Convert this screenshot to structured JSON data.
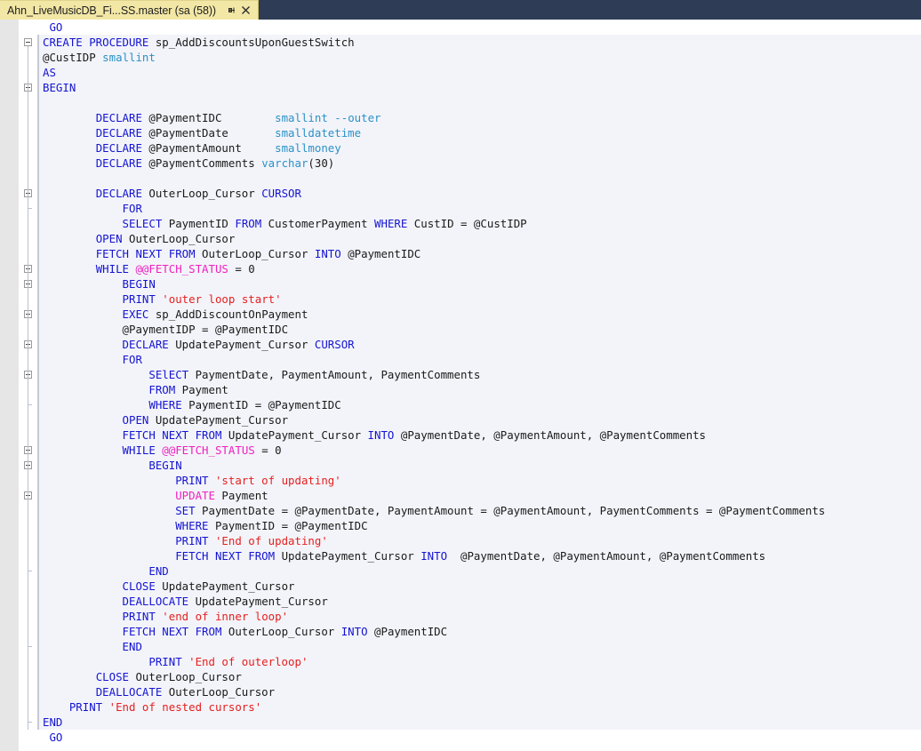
{
  "window": {
    "tab_background": "#2e3c56",
    "active_tab_background": "#f3e7a6",
    "editor_background": "#ffffff",
    "statement_band_background": "#f3f4f9"
  },
  "tab": {
    "title": "Ahn_LiveMusicDB_Fi...SS.master (sa (58))",
    "pin_icon": "pin-icon",
    "close_icon": "close-icon"
  },
  "colors": {
    "keyword": "#1414d2",
    "datatype": "#2b91c8",
    "string": "#e52020",
    "global_variable": "#f020c0",
    "plain_text": "#1a1a1a"
  },
  "editor": {
    "language": "T-SQL",
    "lines": [
      {
        "indent": 1,
        "tokens": [
          {
            "t": "GO",
            "c": "kw"
          }
        ]
      },
      {
        "indent": 0,
        "fold": "start",
        "tokens": [
          {
            "t": "CREATE PROCEDURE ",
            "c": "kw"
          },
          {
            "t": "sp_AddDiscountsUponGuestSwitch",
            "c": "pln"
          }
        ]
      },
      {
        "indent": 0,
        "tokens": [
          {
            "t": "@CustIDP",
            "c": "pln"
          },
          {
            "t": " ",
            "c": "pln"
          },
          {
            "t": "smallint",
            "c": "typ"
          }
        ]
      },
      {
        "indent": 0,
        "tokens": [
          {
            "t": "AS",
            "c": "kw"
          }
        ]
      },
      {
        "indent": 0,
        "fold": "start",
        "tokens": [
          {
            "t": "BEGIN",
            "c": "kw"
          }
        ]
      },
      {
        "indent": 0,
        "tokens": []
      },
      {
        "indent": 8,
        "tokens": [
          {
            "t": "DECLARE ",
            "c": "kw"
          },
          {
            "t": "@PaymentIDC",
            "c": "pln"
          },
          {
            "t": "        ",
            "c": "pln"
          },
          {
            "t": "smallint",
            "c": "typ"
          },
          {
            "t": " ",
            "c": "pln"
          },
          {
            "t": "--outer",
            "c": "typ"
          }
        ]
      },
      {
        "indent": 8,
        "tokens": [
          {
            "t": "DECLARE ",
            "c": "kw"
          },
          {
            "t": "@PaymentDate",
            "c": "pln"
          },
          {
            "t": "       ",
            "c": "pln"
          },
          {
            "t": "smalldatetime",
            "c": "typ"
          }
        ]
      },
      {
        "indent": 8,
        "tokens": [
          {
            "t": "DECLARE ",
            "c": "kw"
          },
          {
            "t": "@PaymentAmount",
            "c": "pln"
          },
          {
            "t": "     ",
            "c": "pln"
          },
          {
            "t": "smallmoney",
            "c": "typ"
          }
        ]
      },
      {
        "indent": 8,
        "tokens": [
          {
            "t": "DECLARE ",
            "c": "kw"
          },
          {
            "t": "@PaymentComments",
            "c": "pln"
          },
          {
            "t": " ",
            "c": "pln"
          },
          {
            "t": "varchar",
            "c": "typ"
          },
          {
            "t": "(30)",
            "c": "pln"
          }
        ]
      },
      {
        "indent": 8,
        "tokens": []
      },
      {
        "indent": 8,
        "fold": "start",
        "tokens": [
          {
            "t": "DECLARE ",
            "c": "kw"
          },
          {
            "t": "OuterLoop_Cursor ",
            "c": "pln"
          },
          {
            "t": "CURSOR",
            "c": "kw"
          }
        ]
      },
      {
        "indent": 12,
        "tokens": [
          {
            "t": "FOR",
            "c": "kw"
          }
        ]
      },
      {
        "indent": 12,
        "tokens": [
          {
            "t": "SELECT ",
            "c": "kw"
          },
          {
            "t": "PaymentID ",
            "c": "pln"
          },
          {
            "t": "FROM ",
            "c": "kw"
          },
          {
            "t": "CustomerPayment ",
            "c": "pln"
          },
          {
            "t": "WHERE ",
            "c": "kw"
          },
          {
            "t": "CustID = @CustIDP",
            "c": "pln"
          }
        ]
      },
      {
        "indent": 8,
        "tokens": [
          {
            "t": "OPEN ",
            "c": "kw"
          },
          {
            "t": "OuterLoop_Cursor",
            "c": "pln"
          }
        ]
      },
      {
        "indent": 8,
        "tokens": [
          {
            "t": "FETCH NEXT FROM ",
            "c": "kw"
          },
          {
            "t": "OuterLoop_Cursor ",
            "c": "pln"
          },
          {
            "t": "INTO ",
            "c": "kw"
          },
          {
            "t": "@PaymentIDC",
            "c": "pln"
          }
        ]
      },
      {
        "indent": 8,
        "fold": "start",
        "tokens": [
          {
            "t": "WHILE ",
            "c": "kw"
          },
          {
            "t": "@@FETCH_STATUS",
            "c": "glb"
          },
          {
            "t": " = 0",
            "c": "pln"
          }
        ]
      },
      {
        "indent": 12,
        "fold": "start",
        "tokens": [
          {
            "t": "BEGIN",
            "c": "kw"
          }
        ]
      },
      {
        "indent": 12,
        "tokens": [
          {
            "t": "PRINT ",
            "c": "kw"
          },
          {
            "t": "'outer loop start'",
            "c": "str"
          }
        ]
      },
      {
        "indent": 12,
        "fold": "start",
        "tokens": [
          {
            "t": "EXEC ",
            "c": "kw"
          },
          {
            "t": "sp_AddDiscountOnPayment",
            "c": "pln"
          }
        ]
      },
      {
        "indent": 12,
        "tokens": [
          {
            "t": "@PaymentIDP = @PaymentIDC",
            "c": "pln"
          }
        ]
      },
      {
        "indent": 12,
        "fold": "start",
        "tokens": [
          {
            "t": "DECLARE ",
            "c": "kw"
          },
          {
            "t": "UpdatePayment_Cursor ",
            "c": "pln"
          },
          {
            "t": "CURSOR",
            "c": "kw"
          }
        ]
      },
      {
        "indent": 12,
        "tokens": [
          {
            "t": "FOR",
            "c": "kw"
          }
        ]
      },
      {
        "indent": 16,
        "fold": "start",
        "tokens": [
          {
            "t": "SElECT ",
            "c": "kw"
          },
          {
            "t": "PaymentDate, PaymentAmount, PaymentComments",
            "c": "pln"
          }
        ]
      },
      {
        "indent": 16,
        "tokens": [
          {
            "t": "FROM ",
            "c": "kw"
          },
          {
            "t": "Payment",
            "c": "pln"
          }
        ]
      },
      {
        "indent": 16,
        "tokens": [
          {
            "t": "WHERE ",
            "c": "kw"
          },
          {
            "t": "PaymentID = @PaymentIDC",
            "c": "pln"
          }
        ]
      },
      {
        "indent": 12,
        "tokens": [
          {
            "t": "OPEN ",
            "c": "kw"
          },
          {
            "t": "UpdatePayment_Cursor",
            "c": "pln"
          }
        ]
      },
      {
        "indent": 12,
        "tokens": [
          {
            "t": "FETCH NEXT FROM ",
            "c": "kw"
          },
          {
            "t": "UpdatePayment_Cursor ",
            "c": "pln"
          },
          {
            "t": "INTO ",
            "c": "kw"
          },
          {
            "t": "@PaymentDate, @PaymentAmount, @PaymentComments",
            "c": "pln"
          }
        ]
      },
      {
        "indent": 12,
        "fold": "start",
        "tokens": [
          {
            "t": "WHILE ",
            "c": "kw"
          },
          {
            "t": "@@FETCH_STATUS",
            "c": "glb"
          },
          {
            "t": " = 0",
            "c": "pln"
          }
        ]
      },
      {
        "indent": 16,
        "fold": "start",
        "tokens": [
          {
            "t": "BEGIN",
            "c": "kw"
          }
        ]
      },
      {
        "indent": 20,
        "tokens": [
          {
            "t": "PRINT ",
            "c": "kw"
          },
          {
            "t": "'start of updating'",
            "c": "str"
          }
        ]
      },
      {
        "indent": 20,
        "fold": "start",
        "tokens": [
          {
            "t": "UPDATE ",
            "c": "glb"
          },
          {
            "t": "Payment",
            "c": "pln"
          }
        ]
      },
      {
        "indent": 20,
        "tokens": [
          {
            "t": "SET ",
            "c": "kw"
          },
          {
            "t": "PaymentDate = @PaymentDate, PaymentAmount = @PaymentAmount, PaymentComments = @PaymentComments",
            "c": "pln"
          }
        ]
      },
      {
        "indent": 20,
        "tokens": [
          {
            "t": "WHERE ",
            "c": "kw"
          },
          {
            "t": "PaymentID = @PaymentIDC",
            "c": "pln"
          }
        ]
      },
      {
        "indent": 20,
        "tokens": [
          {
            "t": "PRINT ",
            "c": "kw"
          },
          {
            "t": "'End of updating'",
            "c": "str"
          }
        ]
      },
      {
        "indent": 20,
        "tokens": [
          {
            "t": "FETCH NEXT FROM ",
            "c": "kw"
          },
          {
            "t": "UpdatePayment_Cursor ",
            "c": "pln"
          },
          {
            "t": "INTO ",
            "c": "kw"
          },
          {
            "t": " @PaymentDate, @PaymentAmount, @PaymentComments",
            "c": "pln"
          }
        ]
      },
      {
        "indent": 16,
        "tokens": [
          {
            "t": "END",
            "c": "kw"
          }
        ]
      },
      {
        "indent": 12,
        "tokens": [
          {
            "t": "CLOSE ",
            "c": "kw"
          },
          {
            "t": "UpdatePayment_Cursor",
            "c": "pln"
          }
        ]
      },
      {
        "indent": 12,
        "tokens": [
          {
            "t": "DEALLOCATE ",
            "c": "kw"
          },
          {
            "t": "UpdatePayment_Cursor",
            "c": "pln"
          }
        ]
      },
      {
        "indent": 12,
        "tokens": [
          {
            "t": "PRINT ",
            "c": "kw"
          },
          {
            "t": "'end of inner loop'",
            "c": "str"
          }
        ]
      },
      {
        "indent": 12,
        "tokens": [
          {
            "t": "FETCH NEXT FROM ",
            "c": "kw"
          },
          {
            "t": "OuterLoop_Cursor ",
            "c": "pln"
          },
          {
            "t": "INTO ",
            "c": "kw"
          },
          {
            "t": "@PaymentIDC",
            "c": "pln"
          }
        ]
      },
      {
        "indent": 12,
        "tokens": [
          {
            "t": "END",
            "c": "kw"
          }
        ]
      },
      {
        "indent": 16,
        "tokens": [
          {
            "t": "PRINT ",
            "c": "kw"
          },
          {
            "t": "'End of outerloop'",
            "c": "str"
          }
        ]
      },
      {
        "indent": 8,
        "tokens": [
          {
            "t": "CLOSE ",
            "c": "kw"
          },
          {
            "t": "OuterLoop_Cursor",
            "c": "pln"
          }
        ]
      },
      {
        "indent": 8,
        "tokens": [
          {
            "t": "DEALLOCATE ",
            "c": "kw"
          },
          {
            "t": "OuterLoop_Cursor",
            "c": "pln"
          }
        ]
      },
      {
        "indent": 4,
        "tokens": [
          {
            "t": "PRINT ",
            "c": "kw"
          },
          {
            "t": "'End of nested cursors'",
            "c": "str"
          }
        ]
      },
      {
        "indent": 0,
        "tokens": [
          {
            "t": "END",
            "c": "kw"
          }
        ]
      },
      {
        "indent": 1,
        "tokens": [
          {
            "t": "GO",
            "c": "kw"
          }
        ]
      }
    ]
  }
}
